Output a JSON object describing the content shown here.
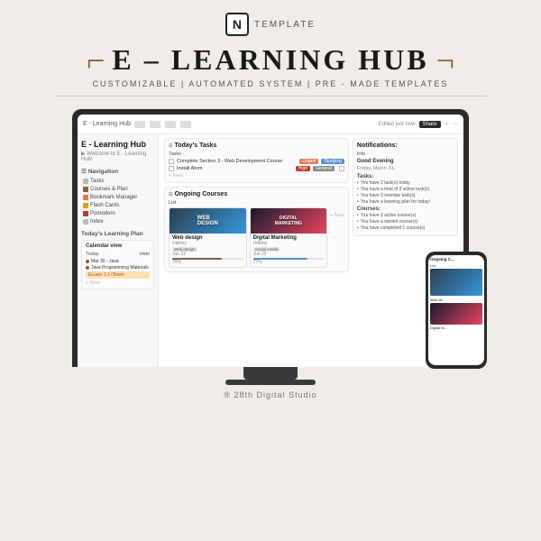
{
  "brand": {
    "notion_letter": "N",
    "template_label": "TEMPLATE",
    "main_title": "E – LEARNING HUB",
    "bracket_left": "⌐",
    "bracket_right": "¬",
    "subtitle": "CUSTOMIZABLE  |  AUTOMATED SYSTEM  |  PRE - MADE TEMPLATES",
    "credits": "® 28th Digital Studio"
  },
  "topbar": {
    "page_name": "E - Learning Hub",
    "edited_label": "Edited just now",
    "share_label": "Share"
  },
  "page": {
    "title": "E - Learning Hub",
    "welcome": "▶ Welcome to E - Learning Hub!"
  },
  "sidebar": {
    "navigation_label": "Navigation",
    "items": [
      {
        "label": "Tasks",
        "icon": "list"
      },
      {
        "label": "Courses & Plan",
        "icon": "book"
      },
      {
        "label": "Bookmark Manager",
        "icon": "bookmark"
      },
      {
        "label": "Flash Cards",
        "icon": "flash"
      },
      {
        "label": "Pomodoro",
        "icon": "pomo"
      },
      {
        "label": "Index",
        "icon": "index"
      }
    ],
    "learning_plan_label": "Today's Learning Plan",
    "calendar_label": "Calendar view",
    "today_label": "Today",
    "hide_label": "Hide",
    "calendar_items": [
      {
        "label": "Mar 30 - Java"
      },
      {
        "label": "Java Programming Materials"
      }
    ],
    "event_label": "Ecuato 1.1 Obiets"
  },
  "tasks_section": {
    "title": "Today's Tasks",
    "sub_label": "Tasks ·",
    "items": [
      {
        "text": "Complete Section 3 - Web Development Course",
        "checked": false,
        "tags": [
          "Urgent",
          "Studying"
        ]
      },
      {
        "text": "Install Atom",
        "checked": false,
        "tags": [
          "High",
          "General"
        ]
      }
    ],
    "add_label": "+ New"
  },
  "courses_section": {
    "title": "Ongoing Courses",
    "list_label": "List",
    "courses": [
      {
        "name": "Web design",
        "platform": "Udemy",
        "category": "Web design",
        "date": "Jun 22",
        "progress": "70%",
        "thumbnail_label": "WEB\nDESIGN"
      },
      {
        "name": "Digital Marketing",
        "platform": "Udemy",
        "category": "Social media",
        "date": "Jun 23",
        "progress": "77%",
        "thumbnail_label": "DIGITAL\nMARKETING"
      }
    ],
    "add_label": "+ New"
  },
  "notifications": {
    "title": "Notifications:",
    "info_label": "Info ·",
    "greeting": "Good Evening",
    "date": "Friday, March 31,",
    "sections": {
      "tasks": {
        "label": "Tasks:",
        "items": [
          "You have 2 task(s) today",
          "You have a total of 3 active task(s)",
          "You have 0 overdue task(s)",
          "You have a learning plan for today!"
        ]
      },
      "courses": {
        "label": "Courses:",
        "items": [
          "You have 2 active course(s)",
          "You have a started course(s)",
          "You have completed 1 course(s)"
        ]
      }
    }
  },
  "phone": {
    "header": "Ongoing C...",
    "list_label": "List",
    "web_design_label": "Web de...",
    "marketing_label": "Digital M..."
  }
}
